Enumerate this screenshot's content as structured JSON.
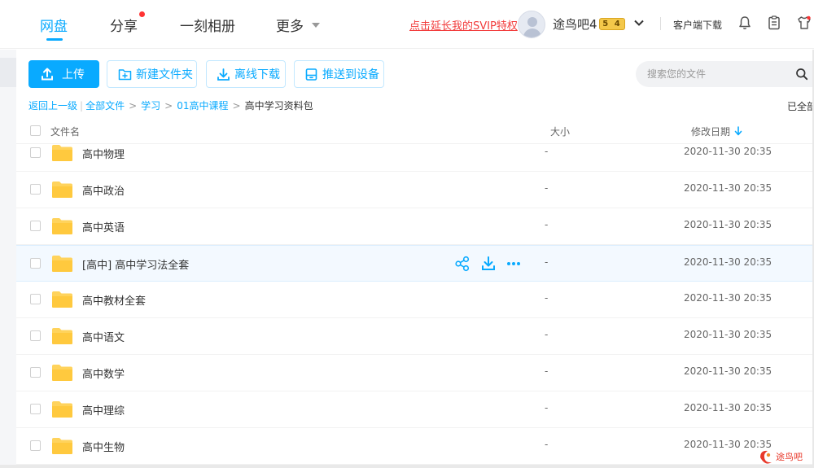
{
  "nav": {
    "items": [
      {
        "label": "网盘",
        "active": true
      },
      {
        "label": "分享",
        "has_dot": true
      },
      {
        "label": "一刻相册"
      },
      {
        "label": "更多"
      }
    ],
    "svip_link": "点击延长我的SVIP特权",
    "username": "途鸟吧4",
    "vip_badge": "5 4",
    "client_download": "客户端下载",
    "icons": [
      "bell-icon",
      "clipboard-icon",
      "shirt-icon"
    ]
  },
  "toolbar": {
    "upload": "上传",
    "new_folder": "新建文件夹",
    "offline_download": "离线下载",
    "push_device": "推送到设备"
  },
  "search": {
    "placeholder": "搜索您的文件"
  },
  "breadcrumb": {
    "back": "返回上一级",
    "items": [
      "全部文件",
      "学习",
      "01高中课程"
    ],
    "current": "高中学习资料包",
    "loaded_status": "已全部"
  },
  "columns": {
    "name": "文件名",
    "size": "大小",
    "date": "修改日期"
  },
  "files": [
    {
      "name": "高中物理",
      "size": "-",
      "date": "2020-11-30 20:35"
    },
    {
      "name": "高中政治",
      "size": "-",
      "date": "2020-11-30 20:35"
    },
    {
      "name": "高中英语",
      "size": "-",
      "date": "2020-11-30 20:35"
    },
    {
      "name": "[高中] 高中学习法全套",
      "size": "-",
      "date": "2020-11-30 20:35",
      "hovered": true
    },
    {
      "name": "高中教材全套",
      "size": "-",
      "date": "2020-11-30 20:35"
    },
    {
      "name": "高中语文",
      "size": "-",
      "date": "2020-11-30 20:35"
    },
    {
      "name": "高中数学",
      "size": "-",
      "date": "2020-11-30 20:35"
    },
    {
      "name": "高中理综",
      "size": "-",
      "date": "2020-11-30 20:35"
    },
    {
      "name": "高中生物",
      "size": "-",
      "date": "2020-11-30 20:35"
    }
  ],
  "row_actions": [
    "share-icon",
    "download-icon",
    "more-icon"
  ],
  "watermark": "途鸟吧",
  "colors": {
    "accent": "#09AAFF",
    "svip_red": "#f23b3b",
    "folder": "#FFC93E",
    "hover_row": "#f3f9ff"
  }
}
